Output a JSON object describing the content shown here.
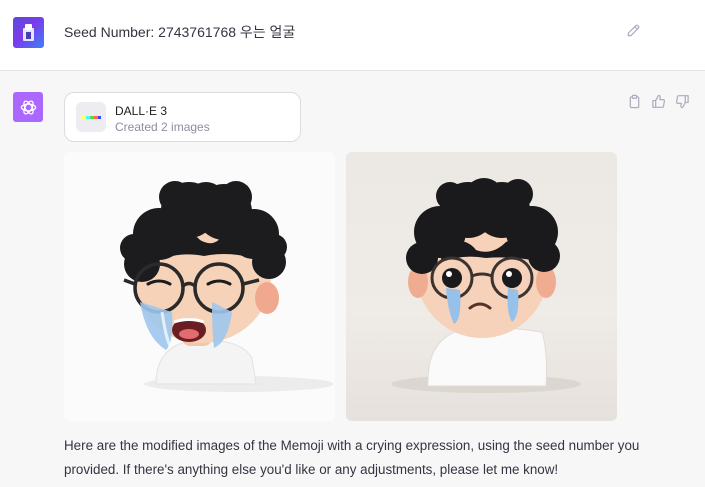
{
  "user_message": {
    "text": "Seed Number: 2743761768 우는 얼굴"
  },
  "assistant": {
    "tool": {
      "name": "DALL·E 3",
      "status": "Created 2 images"
    },
    "images": [
      {
        "expression": "crying-open-mouth"
      },
      {
        "expression": "crying-frown"
      }
    ],
    "reply": "Here are the modified images of the Memoji with a crying expression, using the seed number you provided. If there's anything else you'd like or any adjustments, please let me know!"
  },
  "colors": {
    "assistant_avatar": "#ab68ff",
    "user_row_bg": "#ffffff",
    "assistant_row_bg": "#f7f7f8"
  },
  "icons": [
    "edit-icon",
    "copy-icon",
    "thumbs-up-icon",
    "thumbs-down-icon",
    "openai-logo-icon"
  ]
}
